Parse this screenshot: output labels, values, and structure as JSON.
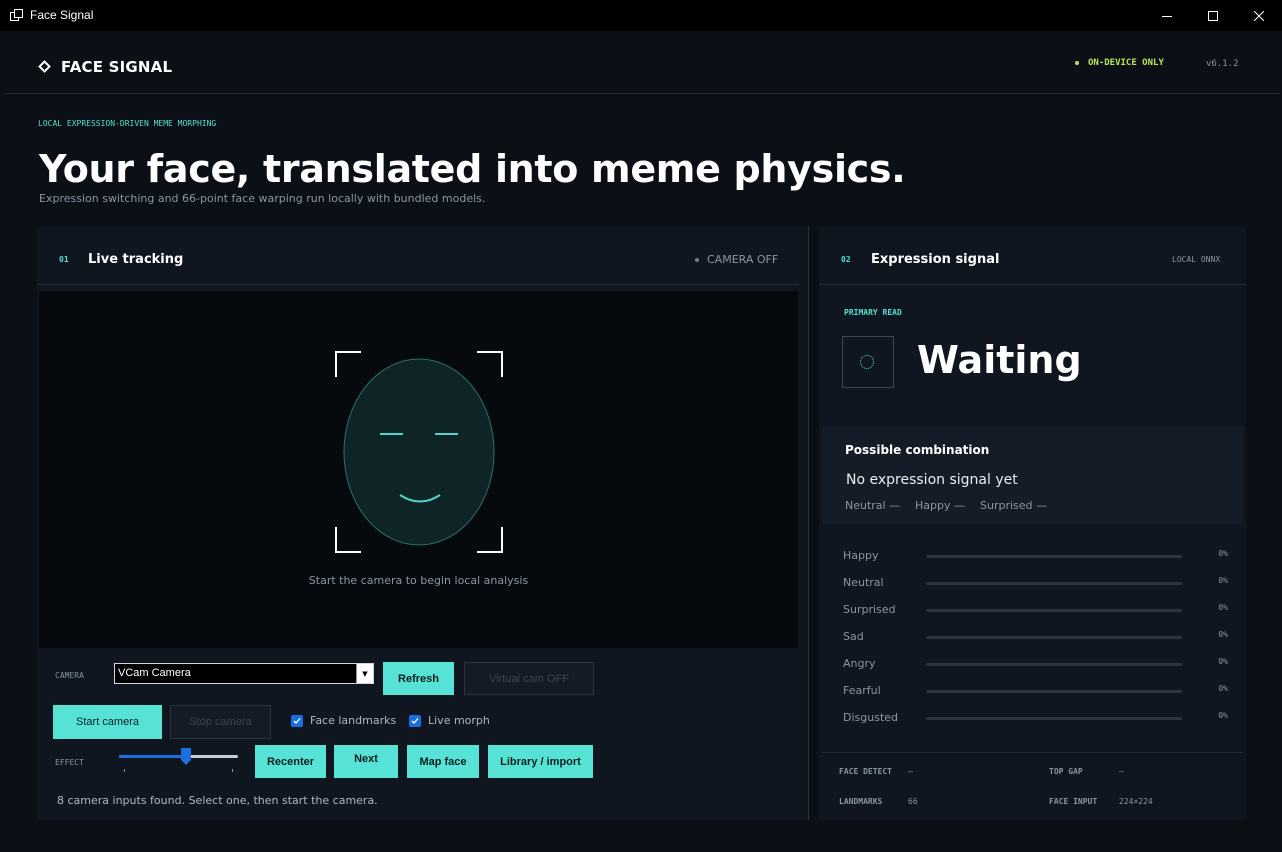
{
  "window": {
    "title": "Face Signal"
  },
  "header": {
    "brand": "FACE SIGNAL",
    "status": "ON-DEVICE ONLY",
    "version": "v6.1.2"
  },
  "hero": {
    "eyebrow": "LOCAL EXPRESSION-DRIVEN MEME MORPHING",
    "title": "Your face, translated into meme physics.",
    "subtitle": "Expression switching and 66-point face warping run locally with bundled models."
  },
  "tracking": {
    "num": "01",
    "title": "Live tracking",
    "camera_status": "CAMERA OFF",
    "hint": "Start the camera to begin local analysis",
    "camera_label": "CAMERA",
    "camera_value": "VCam Camera",
    "refresh_label": "Refresh",
    "virtual_cam_label": "Virtual cam  OFF",
    "start_label": "Start camera",
    "stop_label": "Stop camera",
    "landmarks_label": "Face landmarks",
    "landmarks_checked": true,
    "morph_label": "Live morph",
    "morph_checked": true,
    "effect_label": "EFFECT",
    "effect_level": 0.56,
    "recenter_label": "Recenter",
    "next_label": "Next",
    "map_face_label": "Map face",
    "library_label": "Library / import",
    "status": "8 camera inputs found. Select one, then start the camera."
  },
  "expression": {
    "num": "02",
    "title": "Expression signal",
    "engine": "LOCAL ONNX",
    "primary_label": "PRIMARY READ",
    "primary_value": "Waiting",
    "combo_title": "Possible combination",
    "combo_text": "No expression signal yet",
    "combo_tags": [
      "Neutral —",
      "Happy —",
      "Surprised —"
    ],
    "emotions": [
      {
        "name": "Happy",
        "value": 0,
        "pct": "0%"
      },
      {
        "name": "Neutral",
        "value": 0,
        "pct": "0%"
      },
      {
        "name": "Surprised",
        "value": 0,
        "pct": "0%"
      },
      {
        "name": "Sad",
        "value": 0,
        "pct": "0%"
      },
      {
        "name": "Angry",
        "value": 0,
        "pct": "0%"
      },
      {
        "name": "Fearful",
        "value": 0,
        "pct": "0%"
      },
      {
        "name": "Disgusted",
        "value": 0,
        "pct": "0%"
      }
    ],
    "stats": {
      "face_detect_label": "FACE DETECT",
      "face_detect_value": "—",
      "top_gap_label": "TOP GAP",
      "top_gap_value": "—",
      "landmarks_label": "LANDMARKS",
      "landmarks_value": "66",
      "face_input_label": "FACE INPUT",
      "face_input_value": "224×224"
    }
  },
  "colors": {
    "accent": "#56e3d6",
    "status_green": "#b8e85a",
    "toggle_blue": "#1a6fe0",
    "background": "#0b1017",
    "panel": "#0f161f"
  }
}
